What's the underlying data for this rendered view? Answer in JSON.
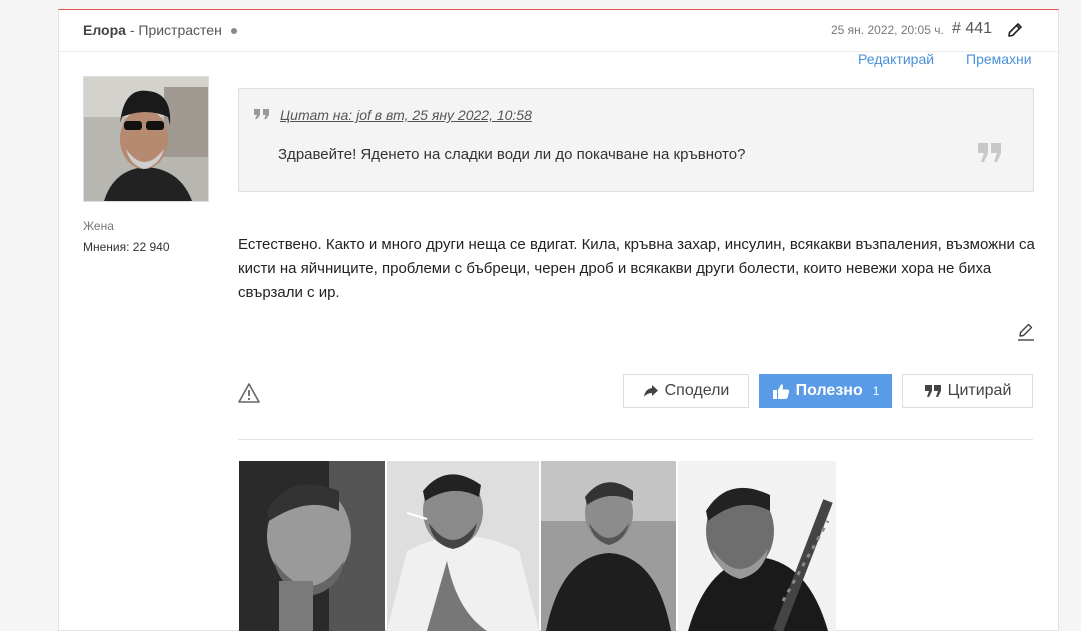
{
  "post": {
    "author": "Елора",
    "author_status": "- Пристрастен",
    "date": "25 ян. 2022, 20:05 ч.",
    "number": "# 441",
    "edit_label": "Редактирай",
    "remove_label": "Премахни"
  },
  "user": {
    "gender": "Жена",
    "opinions": "Мнения: 22 940"
  },
  "quote": {
    "source": "Цитат на: jof в вт, 25 яну 2022, 10:58",
    "text": "Здравейте! Яденето на сладки води ли до покачване на кръвното?"
  },
  "body": {
    "text": "Естествено. Както и много други неща се вдигат. Кила, кръвна захар, инсулин, всякакви възпаления, възможни са кисти на яйчниците, проблеми с бъбреци, черен дроб и всякакви други болести, които невежи хора не биха свързали с ир."
  },
  "buttons": {
    "share": "Сподели",
    "useful": "Полезно",
    "useful_count": "1",
    "quote": "Цитирай"
  },
  "colors": {
    "accent": "#4a90d9",
    "useful_bg": "#5a9be8",
    "top_border": "#e05555"
  }
}
